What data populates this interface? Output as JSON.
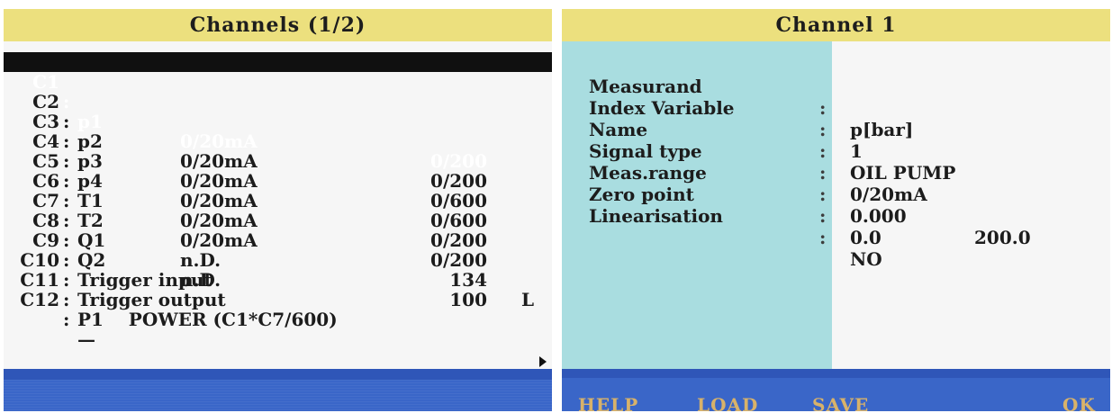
{
  "left": {
    "title": "Channels (1/2)",
    "channels": [
      {
        "id": "C1",
        "colon": ":",
        "sig": "p1",
        "type": "0/20mA",
        "range": "0/200",
        "flag": ""
      },
      {
        "id": "C2",
        "colon": ":",
        "sig": "p2",
        "type": "0/20mA",
        "range": "0/200",
        "flag": ""
      },
      {
        "id": "C3",
        "colon": ":",
        "sig": "p3",
        "type": "0/20mA",
        "range": "0/600",
        "flag": ""
      },
      {
        "id": "C4",
        "colon": ":",
        "sig": "p4",
        "type": "0/20mA",
        "range": "0/600",
        "flag": ""
      },
      {
        "id": "C5",
        "colon": ":",
        "sig": "T1",
        "type": "0/20mA",
        "range": "0/200",
        "flag": ""
      },
      {
        "id": "C6",
        "colon": ":",
        "sig": "T2",
        "type": "0/20mA",
        "range": "0/200",
        "flag": ""
      },
      {
        "id": "C7",
        "colon": ":",
        "sig": "Q1",
        "type": "n.D.",
        "range": "134",
        "flag": "L"
      },
      {
        "id": "C8",
        "colon": ":",
        "sig": "Q2",
        "type": "n.D.",
        "range": "100",
        "flag": ""
      }
    ],
    "extra": [
      {
        "id": "C9",
        "colon": ":",
        "text": "Trigger input"
      },
      {
        "id": "C10",
        "colon": ":",
        "text": "Trigger output"
      },
      {
        "id": "C11",
        "colon": ":",
        "text": "P1    POWER (C1*C7/600)"
      },
      {
        "id": "C12",
        "colon": ":",
        "text": "—"
      }
    ]
  },
  "right": {
    "title": "Channel 1",
    "rows": [
      {
        "label": "Measurand",
        "colon": ":",
        "value": "p[bar]",
        "value2": ""
      },
      {
        "label": "Index Variable",
        "colon": ":",
        "value": "1",
        "value2": ""
      },
      {
        "label": "Name",
        "colon": ":",
        "value": "OIL PUMP",
        "value2": ""
      },
      {
        "label": "Signal type",
        "colon": ":",
        "value": "0/20mA",
        "value2": ""
      },
      {
        "label": "Meas.range",
        "colon": ":",
        "value": "0.000",
        "value2": "200.0"
      },
      {
        "label": "Zero point",
        "colon": ":",
        "value": "0.0",
        "value2": ""
      },
      {
        "label": "Linearisation",
        "colon": ":",
        "value": "NO",
        "value2": ""
      }
    ],
    "softkeys": {
      "help": "HELP",
      "load": "LOAD",
      "save": "SAVE",
      "ok": "OK"
    }
  },
  "colors": {
    "title_bar": "#ece07e",
    "label_column": "#a9dde0",
    "bottom_bar": "#3a66c8",
    "softkey_text": "#d8b26a",
    "selection": "#101010"
  },
  "icons": {
    "scroll_indicator": "arrow-right-icon"
  }
}
